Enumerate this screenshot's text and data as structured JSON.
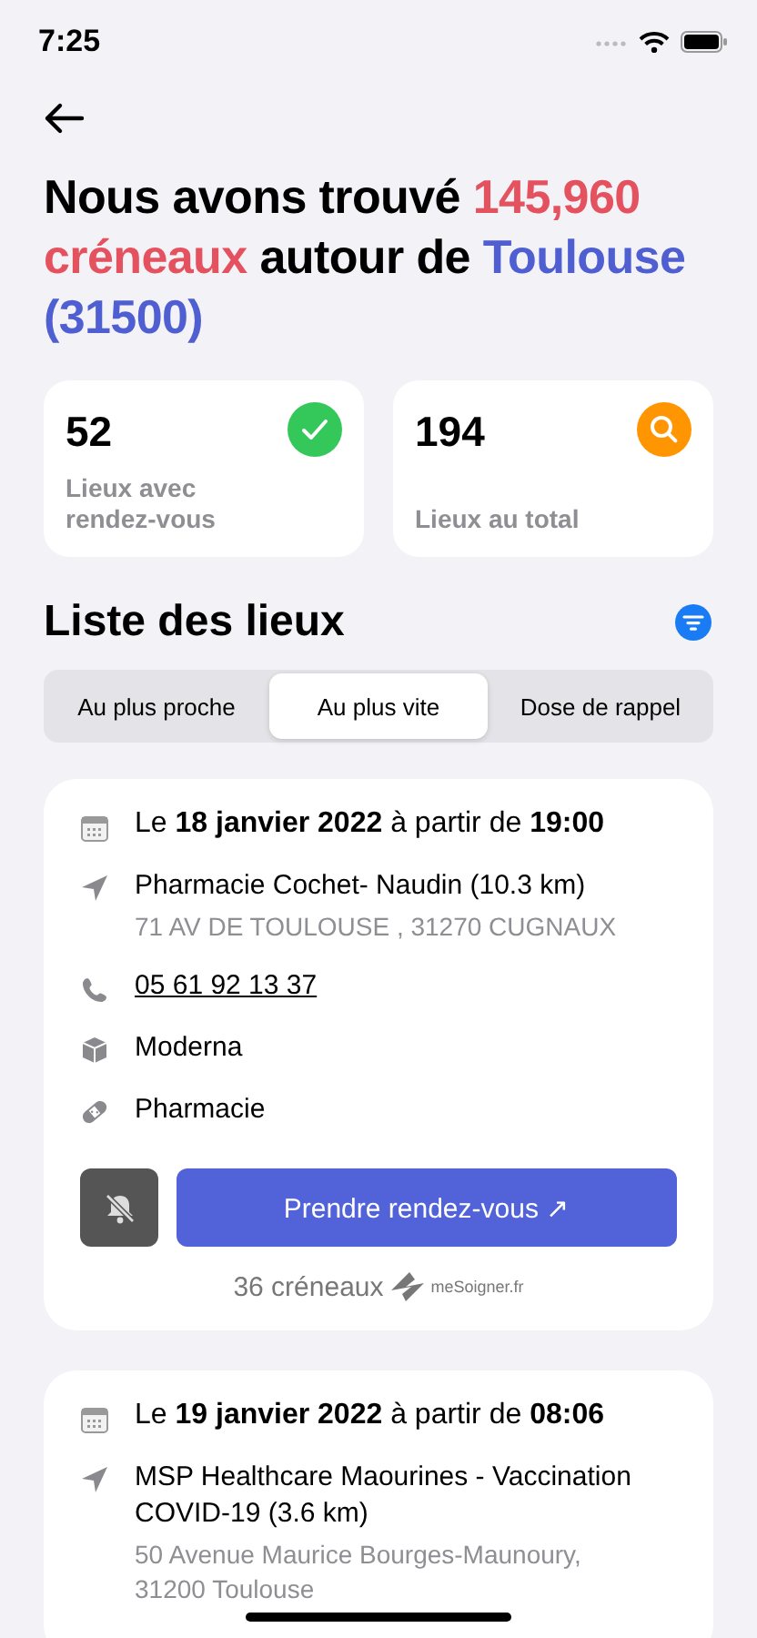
{
  "status_bar": {
    "time": "7:25"
  },
  "headline": [
    {
      "kind": "plain",
      "text": "Nous avons trouvé "
    },
    {
      "kind": "count",
      "text": "145,960 créneaux"
    },
    {
      "kind": "plain",
      "text": " autour de "
    },
    {
      "kind": "place",
      "text": "Toulouse (31500)"
    }
  ],
  "stats": [
    {
      "kind": "check",
      "value": "52",
      "label": "Lieux avec rendez-vous"
    },
    {
      "kind": "search",
      "value": "194",
      "label": "Lieux au total"
    }
  ],
  "list_title": "Liste des lieux",
  "tabs": [
    {
      "label": "Au plus proche",
      "selected": false
    },
    {
      "label": "Au plus vite",
      "selected": true
    },
    {
      "label": "Dose de rappel",
      "selected": false
    }
  ],
  "places": [
    {
      "date": "Le **18 janvier 2022** à partir de **19:00**",
      "name": "Pharmacie Cochet- Naudin (10.3 km)",
      "address": " 71 AV DE TOULOUSE , 31270 CUGNAUX",
      "phone": "05 61 92 13 37",
      "vaccine": "Moderna",
      "type": "Pharmacie",
      "alerts_on": false,
      "book_label": "Prendre rendez-vous ↗",
      "slots": "36 créneaux",
      "source": "meSoigner.fr"
    },
    {
      "date": "Le **19 janvier 2022** à partir de **08:06**",
      "name": "MSP Healthcare Maourines - Vaccination COVID-19 (3.6 km)",
      "address": "50 Avenue Maurice Bourges-Maunoury, 31200 Toulouse"
    }
  ]
}
